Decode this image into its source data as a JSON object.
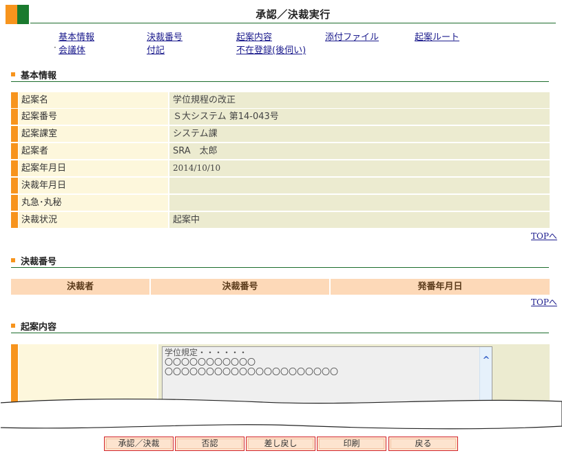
{
  "header": {
    "title": "承認／決裁実行"
  },
  "nav": {
    "links": [
      "基本情報",
      "決裁番号",
      "起案内容",
      "添付ファイル",
      "起案ルート",
      "会議体",
      "付記",
      "不在登録(後伺い)"
    ],
    "bullet": "·"
  },
  "basic_info": {
    "section_title": "基本情報",
    "rows": [
      {
        "label": "起案名",
        "value": "学位規程の改正"
      },
      {
        "label": "起案番号",
        "value": "Ｓ大システム 第14-043号"
      },
      {
        "label": "起案課室",
        "value": "システム課"
      },
      {
        "label": "起案者",
        "value": "SRA　太郎"
      },
      {
        "label": "起案年月日",
        "value": "2014/10/10"
      },
      {
        "label": "決裁年月日",
        "value": ""
      },
      {
        "label": "丸急･丸秘",
        "value": ""
      },
      {
        "label": "決裁状況",
        "value": "起案中"
      }
    ],
    "top_link": "TOPへ"
  },
  "decision": {
    "section_title": "決裁番号",
    "columns": [
      "決裁者",
      "決裁番号",
      "発番年月日"
    ],
    "top_link": "TOPへ"
  },
  "proposal": {
    "section_title": "起案内容",
    "content": "学位規定・・・・・・\n〇〇〇〇〇〇〇〇〇〇〇\n〇〇〇〇〇〇〇〇〇〇〇〇〇〇〇〇〇〇〇〇〇"
  },
  "buttons": {
    "approve": "承認／決裁",
    "reject": "否認",
    "sendback": "差し戻し",
    "print": "印刷",
    "back": "戻る"
  },
  "colors": {
    "accent_orange": "#f7941d",
    "accent_green": "#1a7a2e",
    "label_bg": "#fdf7dc",
    "value_bg": "#ecebd0",
    "table_header_bg": "#fdd9b8",
    "button_border": "#d2232a"
  }
}
